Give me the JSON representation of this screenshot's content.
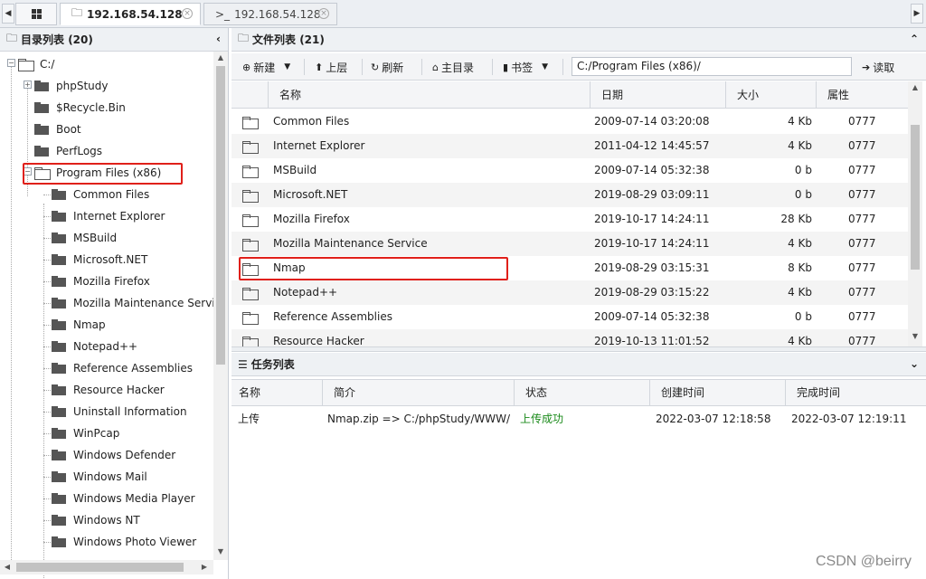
{
  "tabs": {
    "active": "192.168.54.128",
    "inactive": "192.168.54.128",
    "inactive_prefix": ">_"
  },
  "left_panel": {
    "title": "目录列表 (20)",
    "root": "C:/",
    "top_items": [
      "phpStudy",
      "$Recycle.Bin",
      "Boot",
      "PerfLogs",
      "Program Files (x86)"
    ],
    "children": [
      "Common Files",
      "Internet Explorer",
      "MSBuild",
      "Microsoft.NET",
      "Mozilla Firefox",
      "Mozilla Maintenance Servic",
      "Nmap",
      "Notepad++",
      "Reference Assemblies",
      "Resource Hacker",
      "Uninstall Information",
      "WinPcap",
      "Windows Defender",
      "Windows Mail",
      "Windows Media Player",
      "Windows NT",
      "Windows Photo Viewer"
    ]
  },
  "right_panel": {
    "title": "文件列表 (21)",
    "toolbar": {
      "new": "新建",
      "up": "上层",
      "refresh": "刷新",
      "home": "主目录",
      "bookmark": "书签",
      "path": "C:/Program Files (x86)/",
      "read": "读取"
    },
    "columns": [
      "名称",
      "日期",
      "大小",
      "属性"
    ],
    "files": [
      {
        "name": "Common Files",
        "date": "2009-07-14 03:20:08",
        "size": "4 Kb",
        "attr": "0777"
      },
      {
        "name": "Internet Explorer",
        "date": "2011-04-12 14:45:57",
        "size": "4 Kb",
        "attr": "0777"
      },
      {
        "name": "MSBuild",
        "date": "2009-07-14 05:32:38",
        "size": "0 b",
        "attr": "0777"
      },
      {
        "name": "Microsoft.NET",
        "date": "2019-08-29 03:09:11",
        "size": "0 b",
        "attr": "0777"
      },
      {
        "name": "Mozilla Firefox",
        "date": "2019-10-17 14:24:11",
        "size": "28 Kb",
        "attr": "0777"
      },
      {
        "name": "Mozilla Maintenance Service",
        "date": "2019-10-17 14:24:11",
        "size": "4 Kb",
        "attr": "0777"
      },
      {
        "name": "Nmap",
        "date": "2019-08-29 03:15:31",
        "size": "8 Kb",
        "attr": "0777"
      },
      {
        "name": "Notepad++",
        "date": "2019-08-29 03:15:22",
        "size": "4 Kb",
        "attr": "0777"
      },
      {
        "name": "Reference Assemblies",
        "date": "2009-07-14 05:32:38",
        "size": "0 b",
        "attr": "0777"
      },
      {
        "name": "Resource Hacker",
        "date": "2019-10-13 11:01:52",
        "size": "4 Kb",
        "attr": "0777"
      }
    ]
  },
  "tasks": {
    "title": "任务列表",
    "columns": [
      "名称",
      "简介",
      "状态",
      "创建时间",
      "完成时间"
    ],
    "rows": [
      {
        "name": "上传",
        "desc": "Nmap.zip => C:/phpStudy/WWW/",
        "status": "上传成功",
        "created": "2022-03-07 12:18:58",
        "finished": "2022-03-07 12:19:11"
      }
    ]
  },
  "watermark": "CSDN @beirry",
  "colors": {
    "highlight": "#e0201a",
    "success": "#1a8a1a"
  }
}
